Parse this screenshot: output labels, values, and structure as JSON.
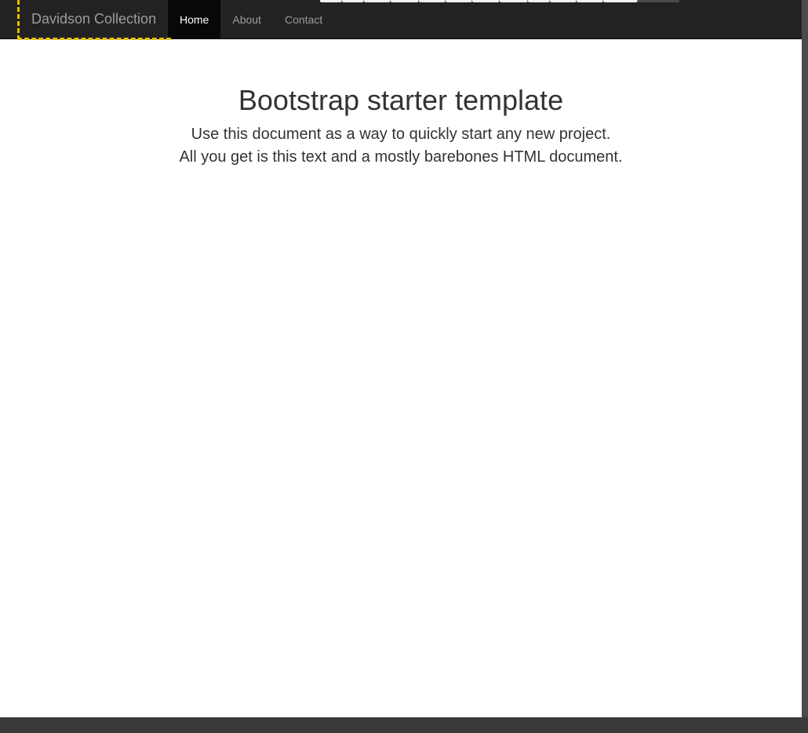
{
  "navbar": {
    "brand": "Davidson Collection",
    "items": [
      {
        "label": "Home",
        "active": true
      },
      {
        "label": "About",
        "active": false
      },
      {
        "label": "Contact",
        "active": false
      }
    ]
  },
  "main": {
    "title": "Bootstrap starter template",
    "lead_line1": "Use this document as a way to quickly start any new project.",
    "lead_line2": "All you get is this text and a mostly barebones HTML document."
  },
  "colors": {
    "navbar_bg": "#222222",
    "active_bg": "#080808",
    "focus_outline": "#e8c300",
    "text": "#333333"
  }
}
